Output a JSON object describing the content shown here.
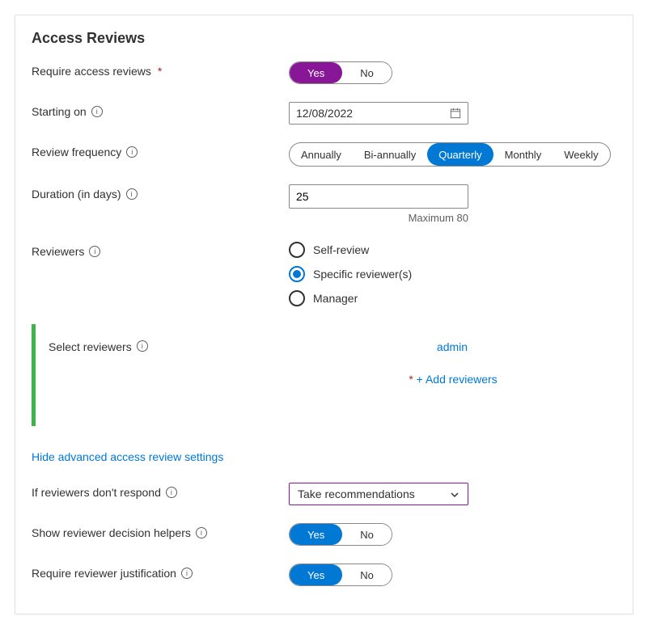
{
  "title": "Access Reviews",
  "requireAccessReviews": {
    "label": "Require access reviews",
    "required": "*",
    "yes": "Yes",
    "no": "No",
    "value": "Yes"
  },
  "startingOn": {
    "label": "Starting on",
    "value": "12/08/2022"
  },
  "reviewFrequency": {
    "label": "Review frequency",
    "options": [
      "Annually",
      "Bi-annually",
      "Quarterly",
      "Monthly",
      "Weekly"
    ],
    "value": "Quarterly"
  },
  "duration": {
    "label": "Duration (in days)",
    "value": "25",
    "hint": "Maximum 80"
  },
  "reviewers": {
    "label": "Reviewers",
    "options": [
      "Self-review",
      "Specific reviewer(s)",
      "Manager"
    ],
    "value": "Specific reviewer(s)"
  },
  "selectReviewers": {
    "label": "Select reviewers",
    "items": [
      "admin"
    ],
    "addLabel": "+ Add reviewers",
    "required": "*"
  },
  "advancedToggle": "Hide advanced access review settings",
  "ifNoRespond": {
    "label": "If reviewers don't respond",
    "value": "Take recommendations"
  },
  "decisionHelpers": {
    "label": "Show reviewer decision helpers",
    "yes": "Yes",
    "no": "No",
    "value": "Yes"
  },
  "requireJustification": {
    "label": "Require reviewer justification",
    "yes": "Yes",
    "no": "No",
    "value": "Yes"
  }
}
